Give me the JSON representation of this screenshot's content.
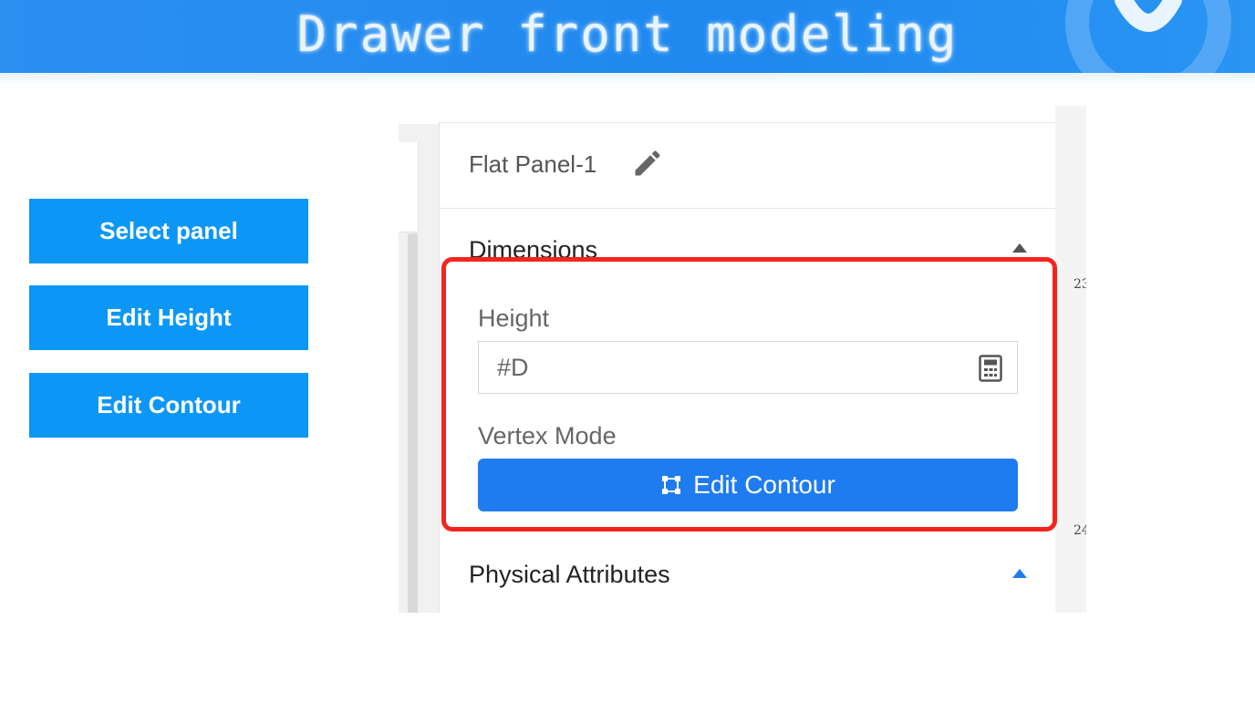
{
  "banner": {
    "title": "Drawer front modeling"
  },
  "steps": [
    {
      "label": "Select panel"
    },
    {
      "label": "Edit Height"
    },
    {
      "label": "Edit Contour"
    }
  ],
  "panel": {
    "title": "Flat Panel-1",
    "dimensions": {
      "section_label": "Dimensions",
      "height_label": "Height",
      "height_value": "#D",
      "vertex_mode_label": "Vertex Mode",
      "edit_contour_label": "Edit Contour"
    },
    "physical_attributes": {
      "section_label": "Physical Attributes"
    }
  },
  "ruler": {
    "top_label": "23",
    "bottom_label": "24"
  },
  "colors": {
    "banner_blue": "#1e88ef",
    "step_button_blue": "#0c97f7",
    "primary_button_blue": "#1f7cf0",
    "highlight_red": "#f4251f",
    "section_caret_blue": "#1f7cf0"
  },
  "icons": {
    "rename": "pencil-icon",
    "calculator": "calculator-icon",
    "contour": "contour-icon",
    "collapse": "caret-up-icon"
  }
}
